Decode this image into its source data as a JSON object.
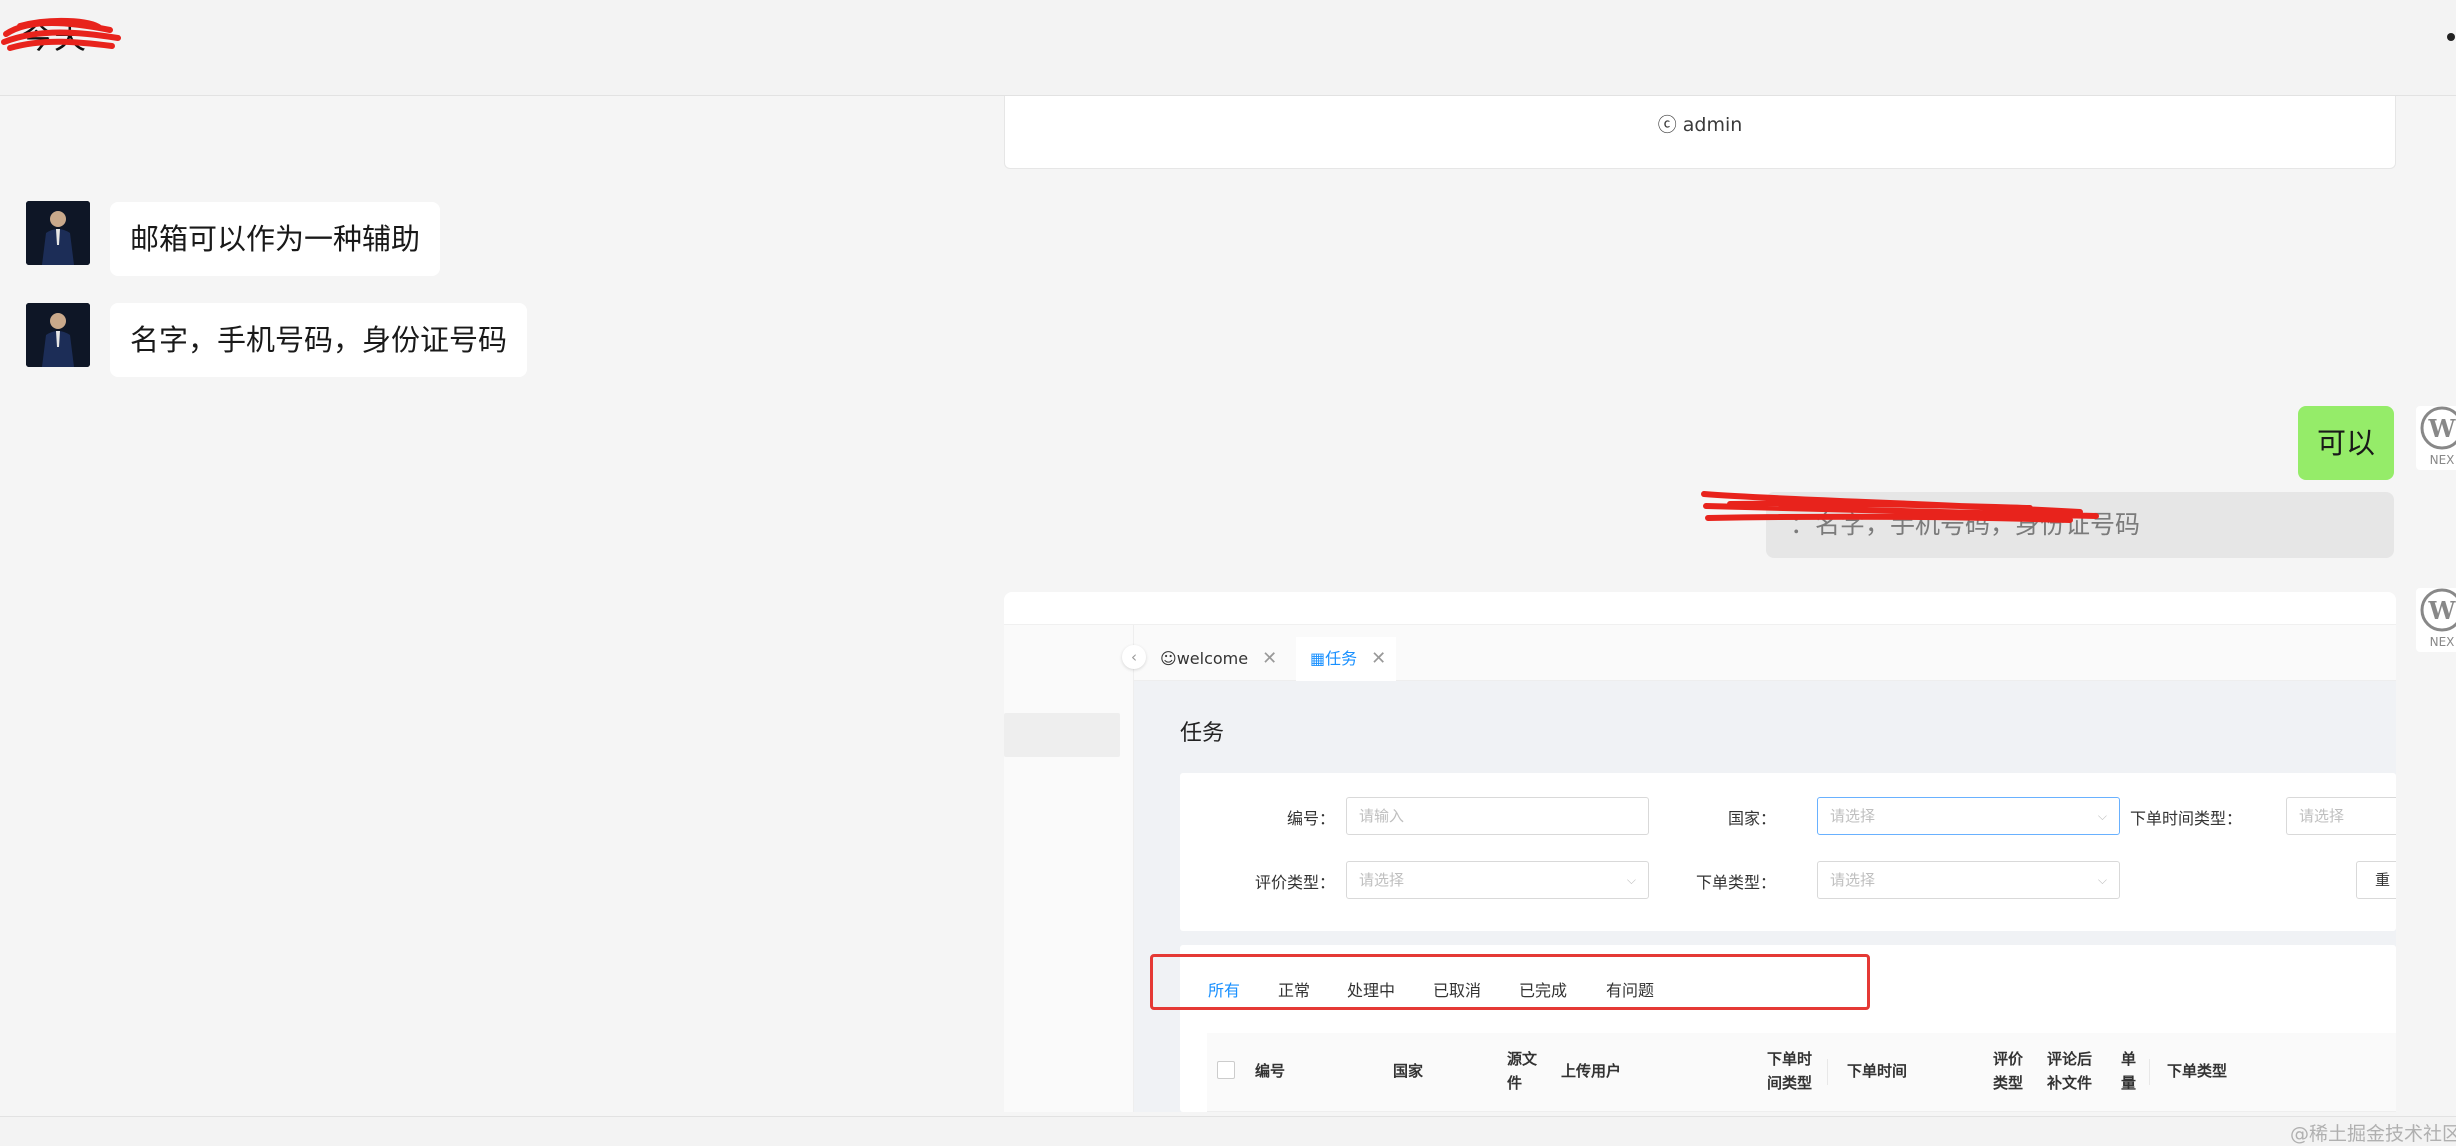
{
  "chat": {
    "title": "今天",
    "more_icon": "more-dot-icon",
    "copyright_text": "ⓒ admin",
    "messages": [
      {
        "from": "left",
        "text": "邮箱可以作为一种辅助"
      },
      {
        "from": "left",
        "text": "名字，手机号码，身份证号码"
      },
      {
        "from": "right",
        "text": "可以"
      },
      {
        "from": "right",
        "quote": "：名字，手机号码，身份证号码"
      }
    ],
    "right_avatar_label": "NEX"
  },
  "screenshot": {
    "tabs": [
      {
        "icon": "smile-icon",
        "label": "welcome"
      },
      {
        "icon": "table-icon",
        "label": "任务"
      }
    ],
    "page_title": "任务",
    "filters": {
      "number_label": "编号：",
      "number_placeholder": "请输入",
      "country_label": "国家：",
      "country_placeholder": "请选择",
      "order_time_type_label": "下单时间类型：",
      "order_time_type_placeholder": "请选择",
      "review_type_label": "评价类型：",
      "review_type_placeholder": "请选择",
      "order_type_label": "下单类型：",
      "order_type_placeholder": "请选择",
      "reset_label": "重"
    },
    "status_tabs": [
      "所有",
      "正常",
      "处理中",
      "已取消",
      "已完成",
      "有问题"
    ],
    "table_headers": {
      "number": "编号",
      "country": "国家",
      "source_file": "源文件",
      "upload_user": "上传用户",
      "order_time_type": "下单时间类型",
      "order_time": "下单时间",
      "review_type": "评价类型",
      "post_review_file": "评论后补文件",
      "quantity": "单量",
      "order_type": "下单类型"
    }
  },
  "footer": {
    "watermark": "@稀土掘金技术社区"
  },
  "colors": {
    "primary": "#1890ff",
    "bubble_green": "#95ec69",
    "highlight": "#e53935"
  }
}
